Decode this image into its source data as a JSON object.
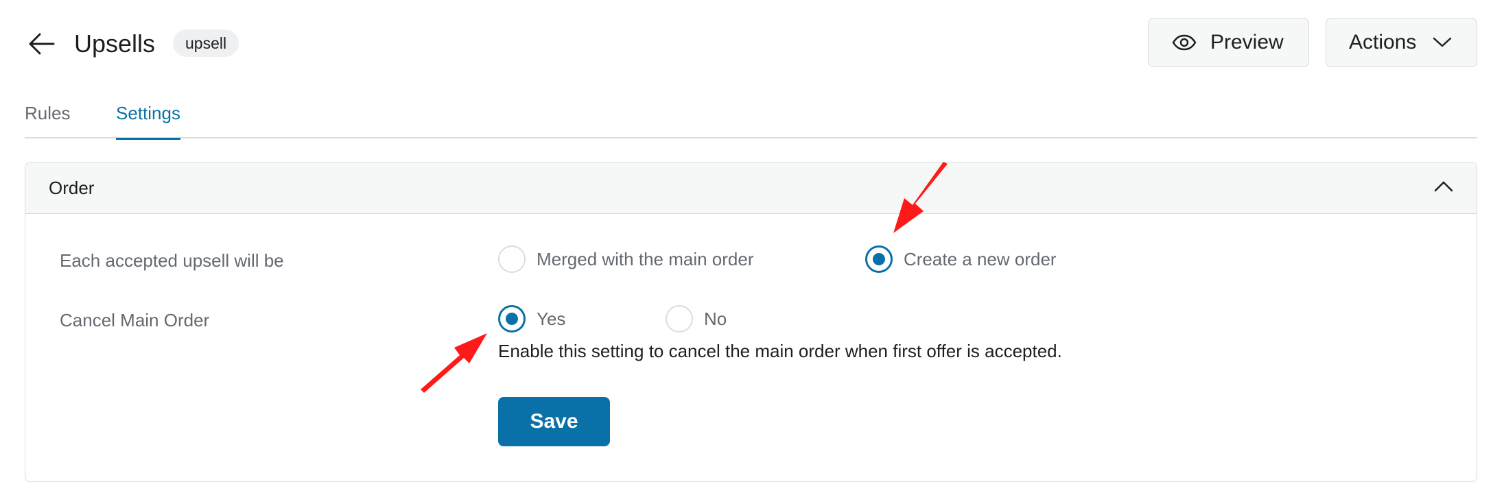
{
  "header": {
    "title": "Upsells",
    "slug_badge": "upsell",
    "preview_label": "Preview",
    "actions_label": "Actions"
  },
  "tabs": [
    {
      "label": "Rules",
      "active": false
    },
    {
      "label": "Settings",
      "active": true
    }
  ],
  "panel": {
    "title": "Order",
    "fields": [
      {
        "label": "Each accepted upsell will be",
        "options": [
          {
            "label": "Merged with the main order",
            "checked": false
          },
          {
            "label": "Create a new order",
            "checked": true
          }
        ]
      },
      {
        "label": "Cancel Main Order",
        "options": [
          {
            "label": "Yes",
            "checked": true
          },
          {
            "label": "No",
            "checked": false
          }
        ],
        "help": "Enable this setting to cancel the main order when first offer is accepted."
      }
    ],
    "save_label": "Save"
  },
  "colors": {
    "accent": "#0a71a8",
    "annotation_arrow": "#ff1a1a"
  },
  "icons": {
    "back": "arrow-left-icon",
    "preview": "eye-icon",
    "actions": "chevron-down-icon",
    "collapse": "chevron-up-icon"
  }
}
